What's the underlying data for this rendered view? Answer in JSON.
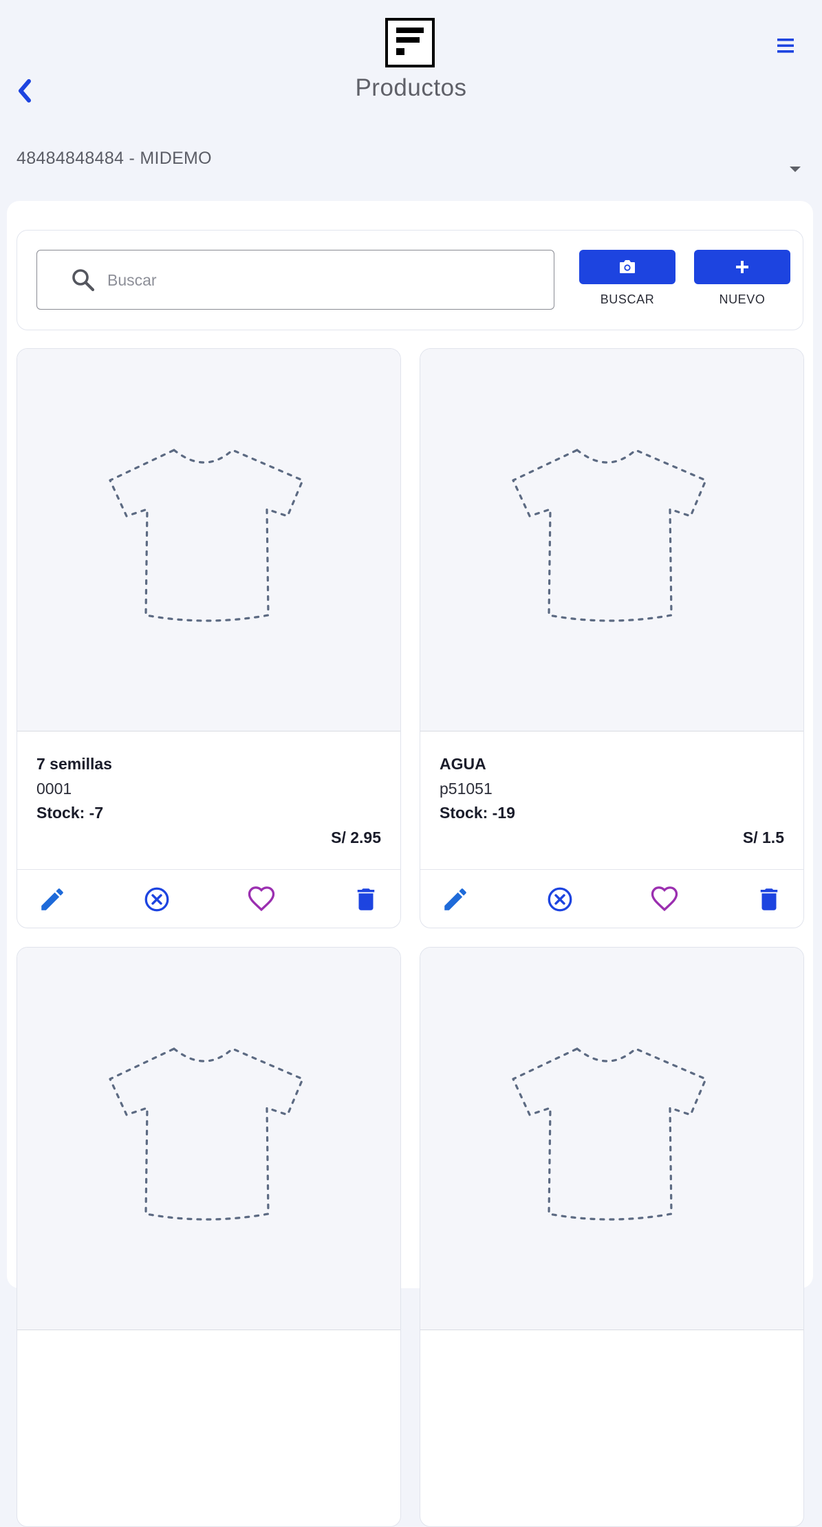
{
  "header": {
    "title": "Productos",
    "logo": "logo-f-icon",
    "menu_icon": "hamburger-menu-icon",
    "back_icon": "chevron-left-icon"
  },
  "company": {
    "selected": "48484848484 - MIDEMO"
  },
  "search": {
    "placeholder": "Buscar",
    "value": ""
  },
  "actions": {
    "scan_label": "BUSCAR",
    "new_label": "NUEVO"
  },
  "products": [
    {
      "name": "7 semillas",
      "code": "0001",
      "stock": "Stock: -7",
      "price": "S/ 2.95"
    },
    {
      "name": "AGUA",
      "code": "p51051",
      "stock": "Stock: -19",
      "price": "S/ 1.5"
    },
    {
      "name": "",
      "code": "",
      "stock": "",
      "price": ""
    },
    {
      "name": "",
      "code": "",
      "stock": "",
      "price": ""
    }
  ],
  "colors": {
    "primary": "#1d44e0",
    "edit": "#1e6ad9",
    "cancel": "#1d44e0",
    "favorite": "#9b2fb0",
    "delete": "#1d44e0",
    "background": "#f2f4fa"
  }
}
